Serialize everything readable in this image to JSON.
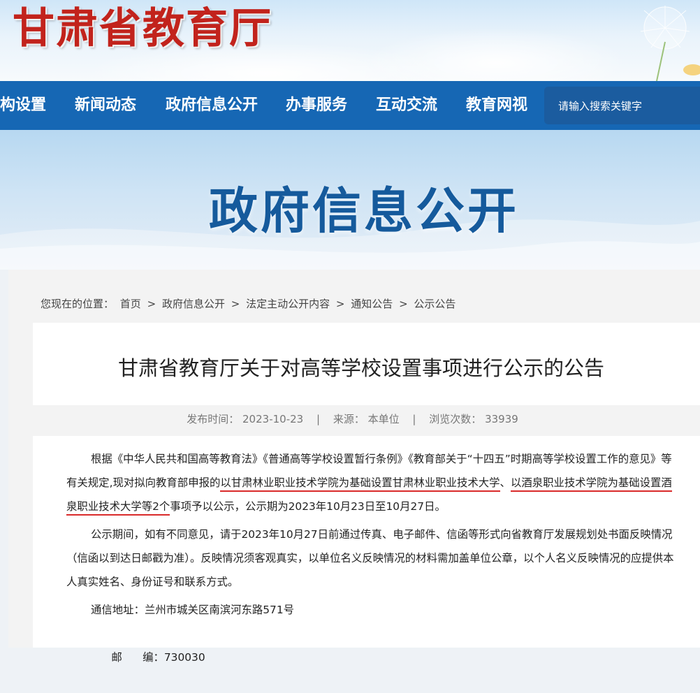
{
  "site": {
    "logo_text": "甘肃省教育厅"
  },
  "nav": {
    "items": [
      "构设置",
      "新闻动态",
      "政府信息公开",
      "办事服务",
      "互动交流",
      "教育网视"
    ],
    "search_placeholder": "请输入搜索关键字"
  },
  "hero": {
    "title": "政府信息公开"
  },
  "breadcrumb": {
    "prefix": "您现在的位置：",
    "items": [
      "首页",
      "政府信息公开",
      "法定主动公开内容",
      "通知公告",
      "公示公告"
    ],
    "separator": ">"
  },
  "article": {
    "title": "甘肃省教育厅关于对高等学校设置事项进行公示的公告",
    "meta": {
      "publish_label": "发布时间：",
      "publish_date": "2023-10-23",
      "source_label": "来源：",
      "source_value": "本单位",
      "views_label": "浏览次数：",
      "views_value": "33939",
      "separator": "|"
    },
    "paragraphs": {
      "p1_part1": "根据《中华人民共和国高等教育法》《普通高等学校设置暂行条例》《教育部关于“十四五”时期高等学校设置工作的意见》等有关规定,现对拟向教育部申报的",
      "p1_highlight1": "以甘肃林业职业技术学院为基础设置甘肃林业职业技术大学",
      "p1_part2": "、",
      "p1_highlight2": "以酒泉职业技术学院为基础设置酒泉职业技术大学等2个",
      "p1_part3": "事项予以公示，公示期为2023年10月23日至10月27日。",
      "p2": "公示期间，如有不同意见，请于2023年10月27日前通过传真、电子邮件、信函等形式向省教育厅发展规划处书面反映情况（信函以到达日邮戳为准）。反映情况须客观真实，以单位名义反映情况的材料需加盖单位公章，以个人名义反映情况的应提供本人真实姓名、身份证号和联系方式。",
      "address_label": "通信地址：",
      "address_value": "兰州市城关区南滨河东路571号",
      "postcode_label": "邮      编：",
      "postcode_value": "730030"
    }
  },
  "colors": {
    "nav_bg": "#1667b4",
    "logo_red": "#c2231c",
    "hero_title": "#155a9c",
    "highlight_underline": "#d92a2a"
  }
}
